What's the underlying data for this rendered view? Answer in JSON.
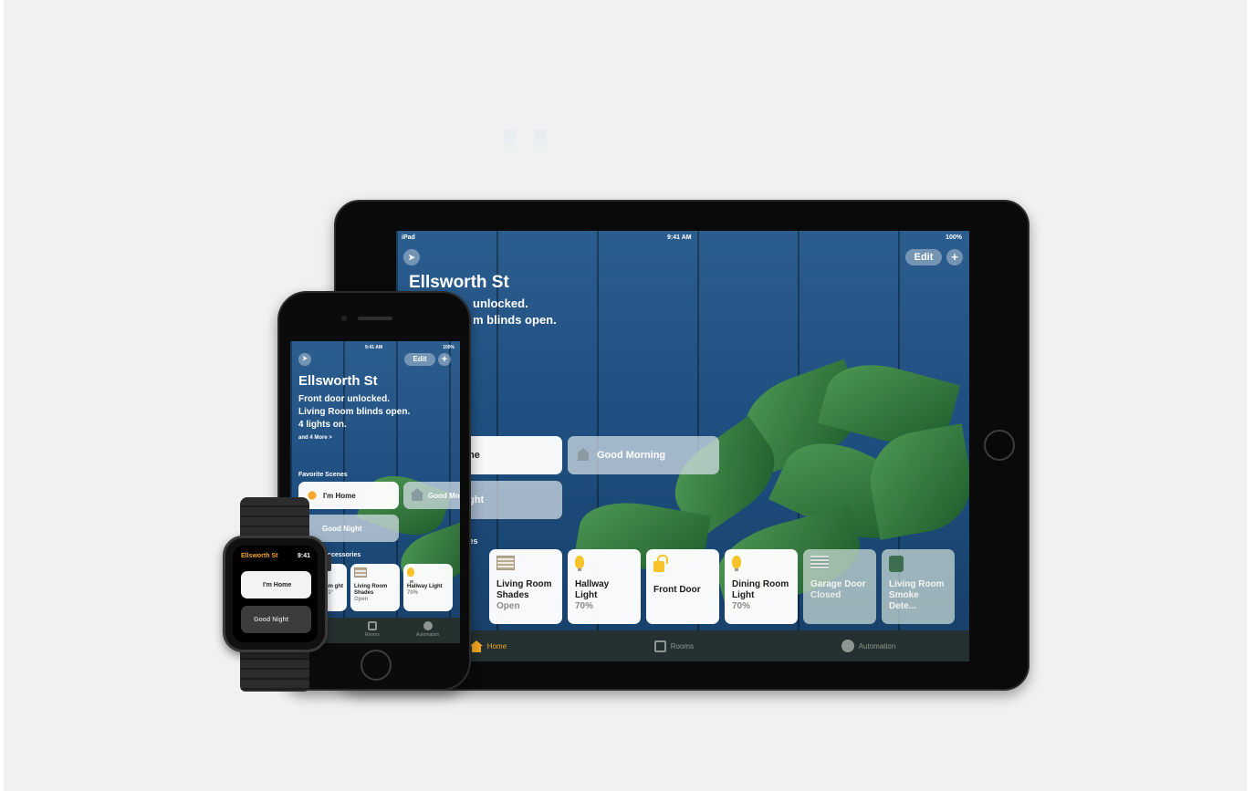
{
  "colors": {
    "accent": "#f5a623",
    "tile_on": "#ffffff",
    "wall_blue": "#1f4f80"
  },
  "ipad": {
    "status": {
      "left": "iPad",
      "time": "9:41 AM",
      "battery": "100%"
    },
    "location_icon": "location-arrow-icon",
    "edit_label": "Edit",
    "add_label": "+",
    "home_name": "Ellsworth St",
    "status_lines": [
      "unlocked.",
      "m blinds open."
    ],
    "scenes": [
      {
        "label": "me",
        "state": "on",
        "icon": "person-icon"
      },
      {
        "label": "Good Morning",
        "state": "off",
        "icon": "house-icon"
      },
      {
        "label": "ight",
        "state": "off",
        "icon": "moon-icon"
      }
    ],
    "accessories_heading": "ories",
    "accessories": [
      {
        "name": "Living Room Shades",
        "state": "Open",
        "icon": "shades-icon",
        "on": true
      },
      {
        "name": "Hallway Light",
        "state": "70%",
        "icon": "bulb-icon",
        "on": true
      },
      {
        "name": "Front Door",
        "state": "",
        "icon": "lock-icon",
        "on": true
      },
      {
        "name": "Dining Room Light",
        "state": "70%",
        "icon": "bulb-icon",
        "on": true
      },
      {
        "name": "Garage Door",
        "state": "Closed",
        "icon": "garage-icon",
        "on": false
      },
      {
        "name": "Living Room Smoke Dete...",
        "state": "",
        "icon": "smoke-icon",
        "on": false
      }
    ],
    "tabs": [
      {
        "label": "Home",
        "icon": "home-icon",
        "active": true
      },
      {
        "label": "Rooms",
        "icon": "rooms-icon",
        "active": false
      },
      {
        "label": "Automation",
        "icon": "automation-icon",
        "active": false
      }
    ]
  },
  "iphone": {
    "status": {
      "time": "9:41 AM",
      "battery": "100%"
    },
    "edit_label": "Edit",
    "add_label": "+",
    "home_name": "Ellsworth St",
    "status_lines": [
      "Front door unlocked.",
      "Living Room blinds open.",
      "4 lights on."
    ],
    "more_link": "and 4 More >",
    "favorite_scenes_label": "Favorite Scenes",
    "scenes": [
      {
        "label": "I'm Home",
        "state": "on"
      },
      {
        "label": "Good Mo",
        "state": "off"
      },
      {
        "label": "Good Night",
        "state": "off"
      }
    ],
    "accessories_heading": "Accessories",
    "accessories": [
      {
        "name": "om ght",
        "state": "72°",
        "on": true
      },
      {
        "name": "Living Room Shades",
        "state": "Open",
        "on": true
      },
      {
        "name": "Hallway Light",
        "state": "70%",
        "on": true
      }
    ],
    "tabs": [
      {
        "label": "Rooms"
      },
      {
        "label": "Automation"
      }
    ]
  },
  "watch": {
    "title": "Ellsworth St",
    "time": "9:41",
    "scenes": [
      {
        "label": "I'm Home",
        "state": "on"
      },
      {
        "label": "Good Night",
        "state": "off"
      }
    ]
  }
}
